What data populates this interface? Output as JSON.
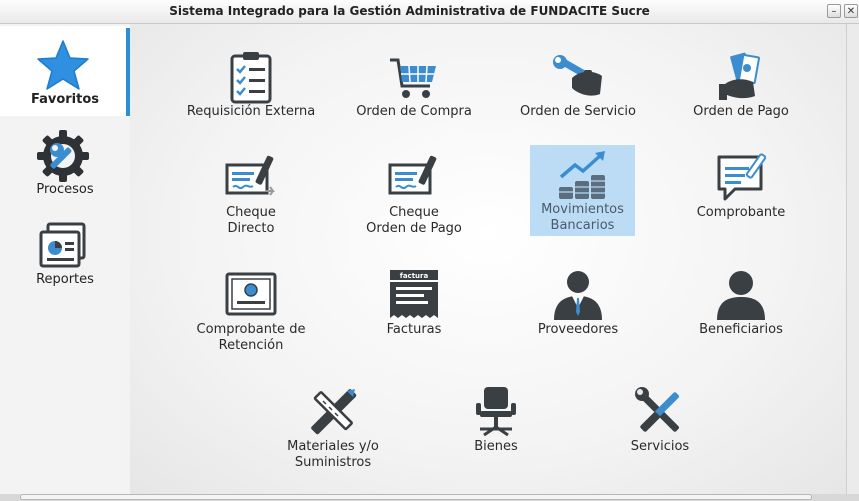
{
  "window": {
    "title": "Sistema Integrado para la Gestión Administrativa de FUNDACITE Sucre",
    "minimize": "–",
    "close": "✕"
  },
  "sidebar": {
    "items": [
      {
        "label": "Favoritos",
        "icon": "star-icon"
      },
      {
        "label": "Procesos",
        "icon": "gear-wrench-icon"
      },
      {
        "label": "Reportes",
        "icon": "reports-icon"
      }
    ]
  },
  "tiles": [
    {
      "line1": "Requisición Externa",
      "line2": "",
      "icon": "clipboard-checklist-icon"
    },
    {
      "line1": "Orden de Compra",
      "line2": "",
      "icon": "shopping-cart-icon"
    },
    {
      "line1": "Orden de Servicio",
      "line2": "",
      "icon": "wrench-hand-icon"
    },
    {
      "line1": "Orden de Pago",
      "line2": "",
      "icon": "money-hand-icon"
    },
    {
      "line1": "Cheque",
      "line2": "Directo",
      "icon": "check-pen-icon"
    },
    {
      "line1": "Cheque",
      "line2": "Orden de Pago",
      "icon": "check-pen-icon"
    },
    {
      "line1": "Movimientos",
      "line2": "Bancarios",
      "icon": "chart-coins-icon",
      "selected": true
    },
    {
      "line1": "Comprobante",
      "line2": "",
      "icon": "message-pen-icon"
    },
    {
      "line1": "Comprobante de",
      "line2": "Retención",
      "icon": "certificate-icon"
    },
    {
      "line1": "Facturas",
      "line2": "",
      "icon": "invoice-icon",
      "badge": "factura"
    },
    {
      "line1": "Proveedores",
      "line2": "",
      "icon": "businessman-icon"
    },
    {
      "line1": "Beneficiarios",
      "line2": "",
      "icon": "person-icon"
    },
    {
      "line1": "Materiales y/o",
      "line2": "Suministros",
      "icon": "pencil-ruler-icon"
    },
    {
      "line1": "Bienes",
      "line2": "",
      "icon": "office-chair-icon"
    },
    {
      "line1": "Servicios",
      "line2": "",
      "icon": "tools-icon"
    }
  ],
  "colors": {
    "accent": "#2b8fd6",
    "selected": "#bcdcf6",
    "icon_dark": "#3a3f44",
    "icon_blue": "#3b8dd0"
  }
}
